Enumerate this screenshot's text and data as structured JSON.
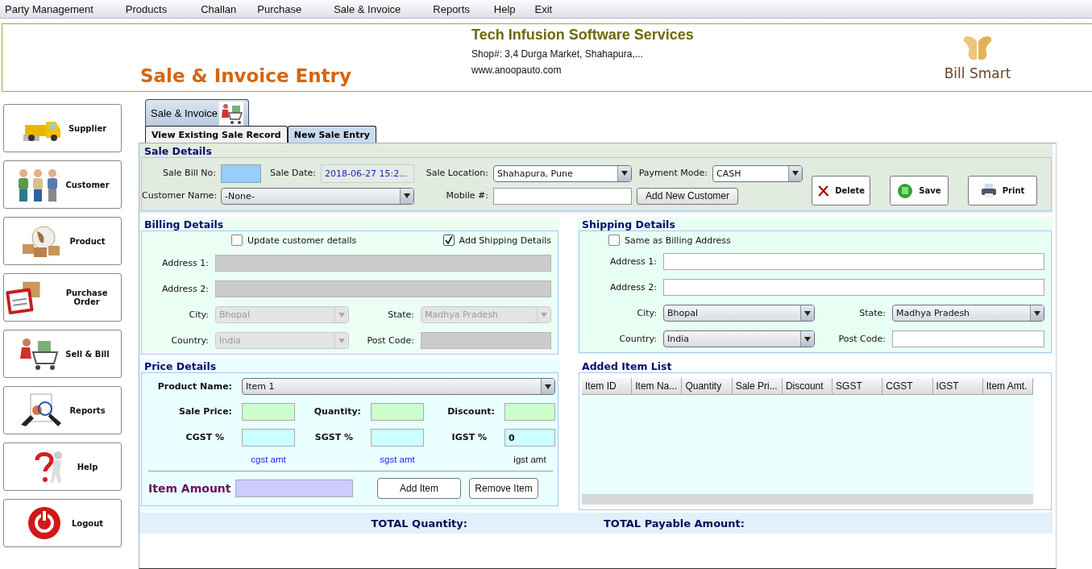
{
  "menu": [
    "Party Management",
    "Products",
    "Challan",
    "Purchase",
    "Sale & Invoice",
    "Reports",
    "Help",
    "Exit"
  ],
  "header": {
    "title": "Sale & Invoice Entry",
    "company": "Tech Infusion Software Services",
    "address": "Shop#: 3,4 Durga Market, Shahapura,...",
    "website": "www.anoopauto.com",
    "logo": "Bill Smart"
  },
  "sidebar": [
    {
      "label": "Supplier",
      "kind": "truck"
    },
    {
      "label": "Customer",
      "kind": "people"
    },
    {
      "label": "Product",
      "kind": "boxes"
    },
    {
      "label": "Purchase Order",
      "kind": "clipboard"
    },
    {
      "label": "Sell & Bill",
      "kind": "cart"
    },
    {
      "label": "Reports",
      "kind": "report"
    },
    {
      "label": "Help",
      "kind": "help"
    },
    {
      "label": "Logout",
      "kind": "power"
    }
  ],
  "main_tab": {
    "label": "Sale & Invoice",
    "selected": true
  },
  "sub_tabs": [
    {
      "label": "View Existing Sale Record",
      "selected": false
    },
    {
      "label": "New Sale Entry",
      "selected": true
    }
  ],
  "sale_details": {
    "title": "Sale Details",
    "bill_no": {
      "label": "Sale Bill No:"
    },
    "sale_date": {
      "label": "Sale Date:",
      "value": "2018-06-27 15:2..."
    },
    "location": {
      "label": "Sale Location:",
      "value": "Shahapura, Pune"
    },
    "payment": {
      "label": "Payment Mode:",
      "value": "CASH"
    },
    "customer": {
      "label": "Customer Name:",
      "value": "-None-"
    },
    "mobile": {
      "label": "Mobile #:"
    },
    "add_customer": "Add New Customer",
    "actions": [
      {
        "label": "Delete",
        "kind": "delete"
      },
      {
        "label": "Save",
        "kind": "save"
      },
      {
        "label": "Print",
        "kind": "print"
      }
    ]
  },
  "billing": {
    "title": "Billing Details",
    "disabled": true,
    "checkboxes": [
      {
        "label": "Update customer details",
        "checked": false
      },
      {
        "label": "Add Shipping Details",
        "checked": true
      }
    ],
    "address_lines": [
      {
        "label": "Address 1:"
      },
      {
        "label": "Address 2:"
      }
    ],
    "city": {
      "label": "City:",
      "value": "Bhopal"
    },
    "state": {
      "label": "State:",
      "value": "Madhya Pradesh"
    },
    "country": {
      "label": "Country:",
      "value": "India"
    },
    "post_code": {
      "label": "Post Code:"
    }
  },
  "shipping": {
    "title": "Shipping Details",
    "disabled": false,
    "checkboxes": [
      {
        "label": "Same as Billing Address",
        "checked": false
      }
    ],
    "address_lines": [
      {
        "label": "Address 1:"
      },
      {
        "label": "Address 2:"
      }
    ],
    "city": {
      "label": "City:",
      "value": "Bhopal"
    },
    "state": {
      "label": "State:",
      "value": "Madhya Pradesh"
    },
    "country": {
      "label": "Country:",
      "value": "India"
    },
    "post_code": {
      "label": "Post Code:"
    }
  },
  "price": {
    "title": "Price Details",
    "product": {
      "label": "Product Name:",
      "value": "Item 1"
    },
    "inputs": [
      {
        "label": "Sale Price:",
        "kind": "price"
      },
      {
        "label": "Quantity:",
        "kind": "price"
      },
      {
        "label": "Discount:",
        "kind": "price"
      },
      {
        "label": "CGST %",
        "kind": "tax"
      },
      {
        "label": "SGST %",
        "kind": "tax"
      },
      {
        "label": "IGST %",
        "kind": "tax",
        "value": "0"
      }
    ],
    "amounts": [
      {
        "text": "cgst amt",
        "color": "#2222ee"
      },
      {
        "text": "sgst amt",
        "color": "#2222ee"
      },
      {
        "text": "igst amt",
        "color": "#111111"
      }
    ],
    "item_amount": {
      "label": "Item Amount"
    },
    "buttons": [
      "Add Item",
      "Remove Item"
    ]
  },
  "item_list": {
    "title": "Added Item List",
    "columns": [
      "Item ID",
      "Item Na...",
      "Quantity",
      "Sale Pri...",
      "Discount",
      "SGST",
      "CGST",
      "IGST",
      "Item Amt."
    ]
  },
  "totals": {
    "quantity": "TOTAL Quantity:",
    "payable": "TOTAL Payable Amount:"
  }
}
